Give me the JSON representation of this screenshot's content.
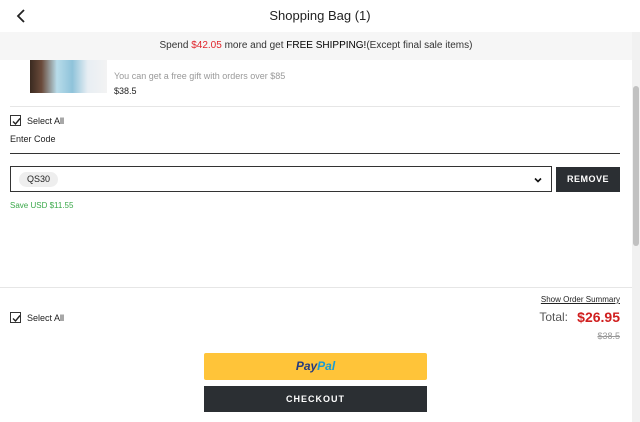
{
  "header": {
    "title": "Shopping Bag",
    "count": "(1)"
  },
  "promo": {
    "prefix": "Spend ",
    "amount": "$42.05",
    "middle": " more and get ",
    "free_shipping": "FREE SHIPPING!",
    "suffix": "(Except final sale items)"
  },
  "item": {
    "gift_note": "You can get a free gift with orders over $85",
    "price": "$38.5"
  },
  "select_all_label": "Select All",
  "coupon": {
    "enter_code_label": "Enter Code",
    "selected_code": "QS30",
    "remove_label": "REMOVE",
    "save_text": "Save USD $11.55"
  },
  "summary": {
    "show_summary_label": "Show Order Summary",
    "total_label": "Total:",
    "total_value": "$26.95",
    "original_price": "$38.5"
  },
  "buttons": {
    "paypal_pay": "Pay",
    "paypal_pal": "Pal",
    "checkout_label": "CHECKOUT"
  },
  "colors": {
    "accent_red": "#e0262c",
    "paypal_yellow": "#ffc439",
    "dark_button": "#2b2f33",
    "save_green": "#3aa84a"
  }
}
